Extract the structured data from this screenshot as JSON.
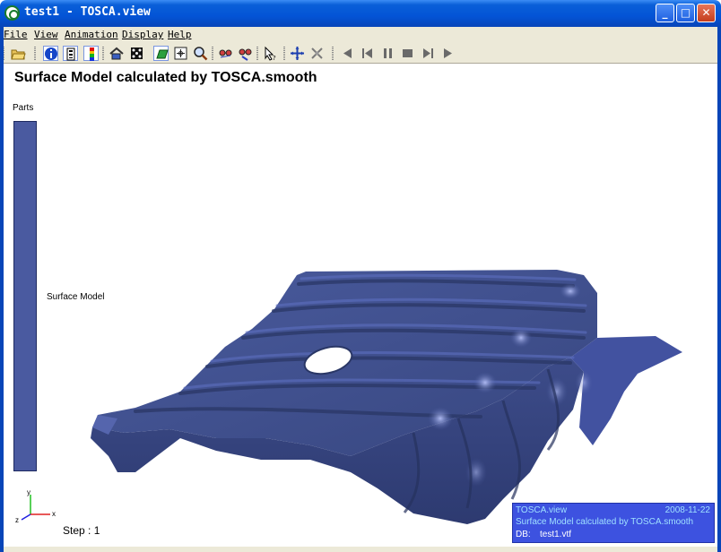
{
  "window": {
    "title": "test1 - TOSCA.view",
    "minimize_glyph": "_",
    "maximize_glyph": "□",
    "close_glyph": "✕"
  },
  "menu": {
    "items": [
      "File",
      "View",
      "Animation",
      "Display",
      "Help"
    ]
  },
  "toolbar": {
    "icons": [
      "open-folder-icon",
      "info-icon",
      "legend-icon",
      "color-scale-icon",
      "home-view-icon",
      "dice-icon",
      "shaded-icon",
      "fit-view-icon",
      "zoom-icon",
      "glasses-icon",
      "glasses-select-icon",
      "pick-pointer-icon",
      "move-icon",
      "rotate-icon",
      "first-frame-icon",
      "step-back-icon",
      "pause-icon",
      "stop-icon",
      "step-forward-icon",
      "play-icon"
    ]
  },
  "viewport": {
    "heading": "Surface Model calculated by TOSCA.smooth",
    "parts_label": "Parts",
    "part_name": "Surface Model",
    "part_color": "#4a5aa0",
    "step_text": "Step : 1",
    "triad": {
      "y": "y",
      "x": "x",
      "z": "z"
    }
  },
  "info_box": {
    "app": "TOSCA.view",
    "date": "2008-11-22",
    "description": "Surface Model calculated by TOSCA.smooth",
    "db_label": "DB:",
    "db_file": "test1.vtf",
    "background": "#3d52e0",
    "text_color": "#9fe0ff"
  },
  "colors": {
    "title_bar": "#0354d6",
    "chrome": "#ece9d8",
    "model_surface": "#3f4f8f"
  }
}
